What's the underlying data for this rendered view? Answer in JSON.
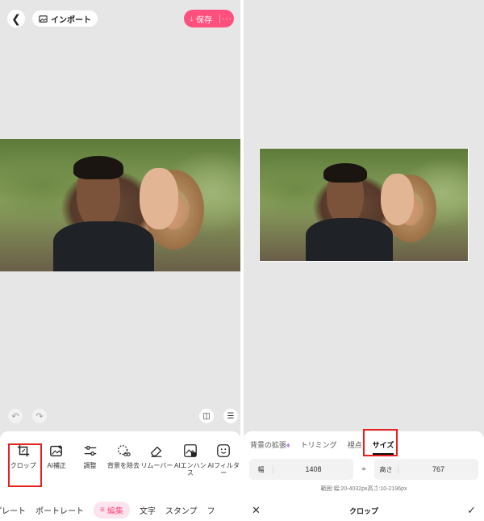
{
  "left": {
    "import_label": "インポート",
    "save_label": "保存",
    "more_label": "···",
    "tools": [
      {
        "label": "クロップ",
        "icon": "crop-icon"
      },
      {
        "label": "AI補正",
        "icon": "ai-enhance-icon"
      },
      {
        "label": "調整",
        "icon": "adjust-icon"
      },
      {
        "label": "背景を除去",
        "icon": "remove-bg-icon"
      },
      {
        "label": "リムーバー",
        "icon": "eraser-icon"
      },
      {
        "label": "AIエンハンス",
        "icon": "ai-enhance-image-icon"
      },
      {
        "label": "AIフィルター",
        "icon": "ai-filter-icon"
      }
    ],
    "bottom_tabs": [
      "プレート",
      "ポートレート",
      "編集",
      "文字",
      "スタンプ",
      "フ"
    ]
  },
  "right": {
    "tabs": [
      "背景の拡張",
      "トリミング",
      "視点",
      "サイズ"
    ],
    "width_label": "幅",
    "width_value": "1408",
    "height_label": "高さ",
    "height_value": "767",
    "range_text": "範囲:幅:20-4032px高さ:10-2196px",
    "footer_title": "クロップ"
  },
  "colors": {
    "accent": "#ff4f7d",
    "highlight": "#e82020",
    "canvas_bg": "#e6e6e6"
  }
}
